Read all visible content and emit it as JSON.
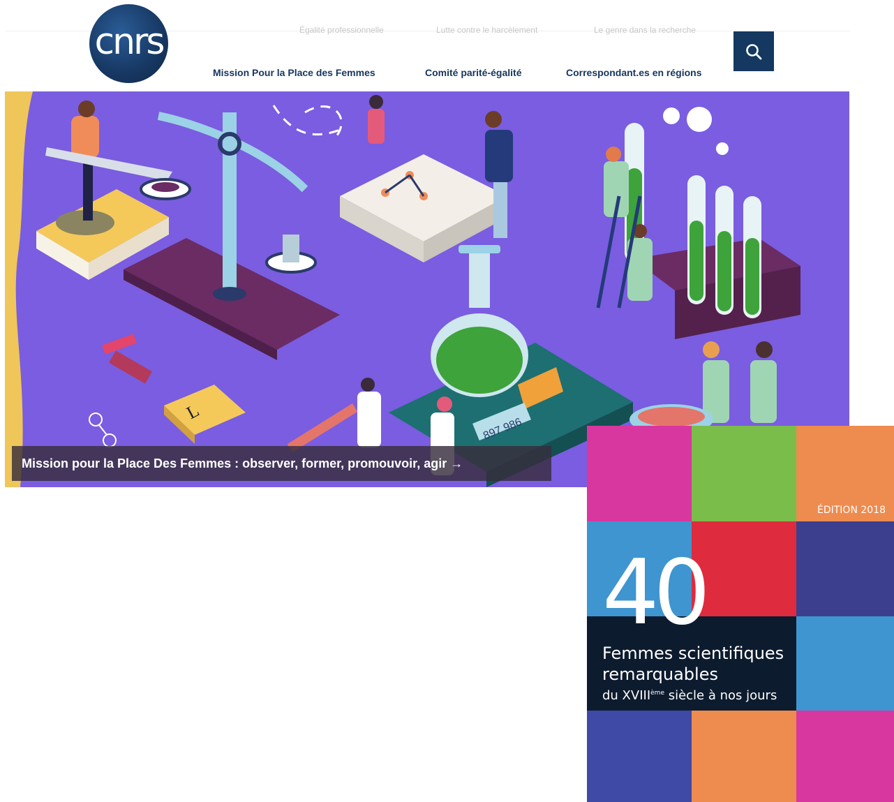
{
  "header": {
    "logo_text": "cnrs",
    "top_links": [
      "Égalité professionnelle",
      "Lutte contre le harcèlement",
      "Le genre dans la recherche"
    ],
    "main_nav": [
      "Mission Pour la Place des Femmes",
      "Comité parité-égalité",
      "Correspondant.es en régions"
    ],
    "search_icon": "search-icon"
  },
  "hero": {
    "caption": "Mission pour la Place Des Femmes : observer, former, promouvoir, agir →",
    "book_letter": "L",
    "scale_readout": "897 986"
  },
  "poster": {
    "edition": "ÉDITION 2018",
    "number": "40",
    "title_line1": "Femmes scientifiques",
    "title_line2": "remarquables",
    "subtitle_pre": "du XVIII",
    "subtitle_sup": "ème",
    "subtitle_post": " siècle à nos jours"
  },
  "colors": {
    "navy": "#14385f",
    "hero_purple": "#7a5de0",
    "poster_band": "#0d1b2e"
  }
}
